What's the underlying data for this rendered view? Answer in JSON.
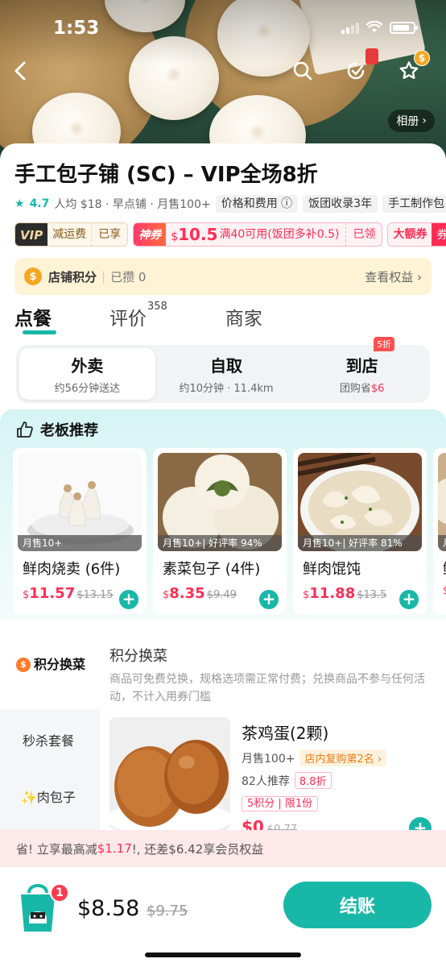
{
  "status_bar": {
    "time": "1:53"
  },
  "header": {
    "album_label": "相册",
    "coin_badge": "$"
  },
  "store": {
    "name": "手工包子铺 (SC) – VIP全场8折",
    "rating": "4.7",
    "meta": "人均 $18 · 早点铺 · 月售100+",
    "chips": [
      "价格和费用 ⓘ",
      "饭团收录3年",
      "手工制作包"
    ],
    "promos": {
      "vip_tag": "VIP",
      "vip_text": "减运费",
      "vip_state": "已享",
      "coupon_tag": "神券",
      "coupon_currency": "$",
      "coupon_amount": "10.5",
      "coupon_desc": "满40可用(饭团多补0.5)",
      "coupon_state": "已领",
      "big_tag": "大额券",
      "big_tag2": "券"
    },
    "points": {
      "icon": "$",
      "label": "店铺积分",
      "value": "已攒 0",
      "link": "查看权益 ›"
    }
  },
  "tabs": [
    {
      "label": "点餐",
      "sup": ""
    },
    {
      "label": "评价",
      "sup": "358"
    },
    {
      "label": "商家",
      "sup": ""
    }
  ],
  "modes": [
    {
      "label": "外卖",
      "sub": "约56分钟送达",
      "sub_red": "",
      "badge": ""
    },
    {
      "label": "自取",
      "sub": "约10分钟 · 11.4km",
      "sub_red": "",
      "badge": ""
    },
    {
      "label": "到店",
      "sub": "团购省",
      "sub_red": "$6",
      "badge": "5折"
    }
  ],
  "recommend": {
    "title": "老板推荐",
    "items": [
      {
        "name": "鲜肉烧卖 (6件)",
        "sales": "月售10+",
        "currency": "$",
        "price": "11.57",
        "orig": "$13.15"
      },
      {
        "name": "素菜包子 (4件)",
        "sales": "月售10+| 好评率 94%",
        "currency": "$",
        "price": "8.35",
        "orig": "$9.49"
      },
      {
        "name": "鲜肉馄饨",
        "sales": "月售10+| 好评率 81%",
        "currency": "$",
        "price": "11.88",
        "orig": "$13.5"
      },
      {
        "name": "鲜",
        "sales": "月",
        "currency": "$",
        "price": "",
        "orig": ""
      }
    ]
  },
  "menu": {
    "sidebar": [
      {
        "icon": "$",
        "label": "积分换菜"
      },
      {
        "icon": "",
        "label": "秒杀套餐"
      },
      {
        "icon": "✨",
        "label": "肉包子"
      }
    ],
    "category_title": "积分换菜",
    "category_desc": "商品可免费兑换，规格选项需正常付费；兑换商品不参与任何活动，不计入用券门槛",
    "dish": {
      "name": "茶鸡蛋(2颗)",
      "sales": "月售100+",
      "rank": "店内复购第2名 ›",
      "recommend": "82人推荐",
      "discount": "8.8折",
      "limit": "5积分 | 限1份",
      "price": "$0",
      "orig": "$0.77"
    }
  },
  "bottom": {
    "save_prefix": "省! 立享最高减",
    "save_amount": "$1.17",
    "save_suffix": "!, 还差$6.42享会员权益",
    "cart_count": "1",
    "total": "$8.58",
    "total_orig": "$9.75",
    "checkout_label": "结账"
  },
  "colors": {
    "accent": "#19b7a8",
    "price_red": "#ff2d55",
    "points_bg": "#fff3d6"
  }
}
